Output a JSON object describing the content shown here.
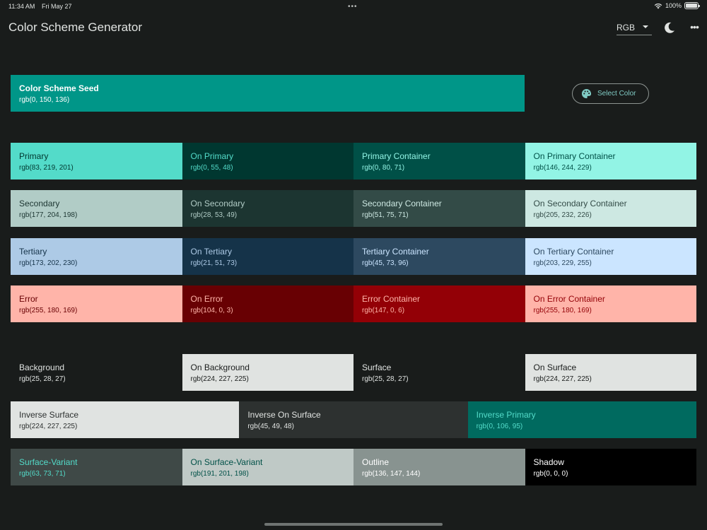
{
  "status_bar": {
    "time": "11:34 AM",
    "date": "Fri May 27",
    "battery": "100%"
  },
  "app": {
    "title": "Color Scheme Generator",
    "format": "RGB"
  },
  "seed": {
    "name": "Color Scheme Seed",
    "value": "rgb(0, 150, 136)",
    "color": "#009688",
    "select_label": "Select Color"
  },
  "rows": [
    [
      {
        "name": "Primary",
        "value": "rgb(83, 219, 201)",
        "bg": "#53dbc9",
        "fg": "#00372f"
      },
      {
        "name": "On Primary",
        "value": "rgb(0, 55, 48)",
        "bg": "#003730",
        "fg": "#53dbc9"
      },
      {
        "name": "Primary Container",
        "value": "rgb(0, 80, 71)",
        "bg": "#005047",
        "fg": "#92f4e5"
      },
      {
        "name": "On Primary Container",
        "value": "rgb(146, 244, 229)",
        "bg": "#92f4e5",
        "fg": "#005047"
      }
    ],
    [
      {
        "name": "Secondary",
        "value": "rgb(177, 204, 198)",
        "bg": "#b1ccc6",
        "fg": "#1c3531"
      },
      {
        "name": "On Secondary",
        "value": "rgb(28, 53, 49)",
        "bg": "#1c3531",
        "fg": "#b1ccc6"
      },
      {
        "name": "Secondary Container",
        "value": "rgb(51, 75, 71)",
        "bg": "#334b47",
        "fg": "#cde8e2"
      },
      {
        "name": "On Secondary Container",
        "value": "rgb(205, 232, 226)",
        "bg": "#cde8e2",
        "fg": "#334b47"
      }
    ],
    [
      {
        "name": "Tertiary",
        "value": "rgb(173, 202, 230)",
        "bg": "#adcae6",
        "fg": "#153349"
      },
      {
        "name": "On Tertiary",
        "value": "rgb(21, 51, 73)",
        "bg": "#153349",
        "fg": "#adcae6"
      },
      {
        "name": "Tertiary Container",
        "value": "rgb(45, 73, 96)",
        "bg": "#2d4960",
        "fg": "#cbe5ff"
      },
      {
        "name": "On Tertiary Container",
        "value": "rgb(203, 229, 255)",
        "bg": "#cbe5ff",
        "fg": "#2d4960"
      }
    ],
    [
      {
        "name": "Error",
        "value": "rgb(255, 180, 169)",
        "bg": "#ffb4a9",
        "fg": "#680003"
      },
      {
        "name": "On Error",
        "value": "rgb(104, 0, 3)",
        "bg": "#680003",
        "fg": "#ffb4a9"
      },
      {
        "name": "Error Container",
        "value": "rgb(147, 0, 6)",
        "bg": "#930006",
        "fg": "#ffb4a9"
      },
      {
        "name": "On Error Container",
        "value": "rgb(255, 180, 169)",
        "bg": "#ffb4a9",
        "fg": "#930006"
      }
    ],
    [
      {
        "name": "Background",
        "value": "rgb(25, 28, 27)",
        "bg": "#191c1b",
        "fg": "#e0e3e1"
      },
      {
        "name": "On Background",
        "value": "rgb(224, 227, 225)",
        "bg": "#e0e3e1",
        "fg": "#191c1b"
      },
      {
        "name": "Surface",
        "value": "rgb(25, 28, 27)",
        "bg": "#191c1b",
        "fg": "#e0e3e1"
      },
      {
        "name": "On Surface",
        "value": "rgb(224, 227, 225)",
        "bg": "#e0e3e1",
        "fg": "#191c1b"
      }
    ],
    [
      {
        "name": "Inverse Surface",
        "value": "rgb(224, 227, 225)",
        "bg": "#e0e3e1",
        "fg": "#2d3130"
      },
      {
        "name": "Inverse On Surface",
        "value": "rgb(45, 49, 48)",
        "bg": "#2d3130",
        "fg": "#e0e3e1"
      },
      {
        "name": "Inverse Primary",
        "value": "rgb(0, 106, 95)",
        "bg": "#006a5f",
        "fg": "#53dbc9"
      }
    ],
    [
      {
        "name": "Surface-Variant",
        "value": "rgb(63, 73, 71)",
        "bg": "#3f4947",
        "fg": "#53dbc9"
      },
      {
        "name": "On Surface-Variant",
        "value": "rgb(191, 201, 198)",
        "bg": "#bfc9c6",
        "fg": "#005047"
      },
      {
        "name": "Outline",
        "value": "rgb(136, 147, 144)",
        "bg": "#889390",
        "fg": "#ffffff"
      },
      {
        "name": "Shadow",
        "value": "rgb(0, 0, 0)",
        "bg": "#000000",
        "fg": "#ffffff"
      }
    ]
  ]
}
